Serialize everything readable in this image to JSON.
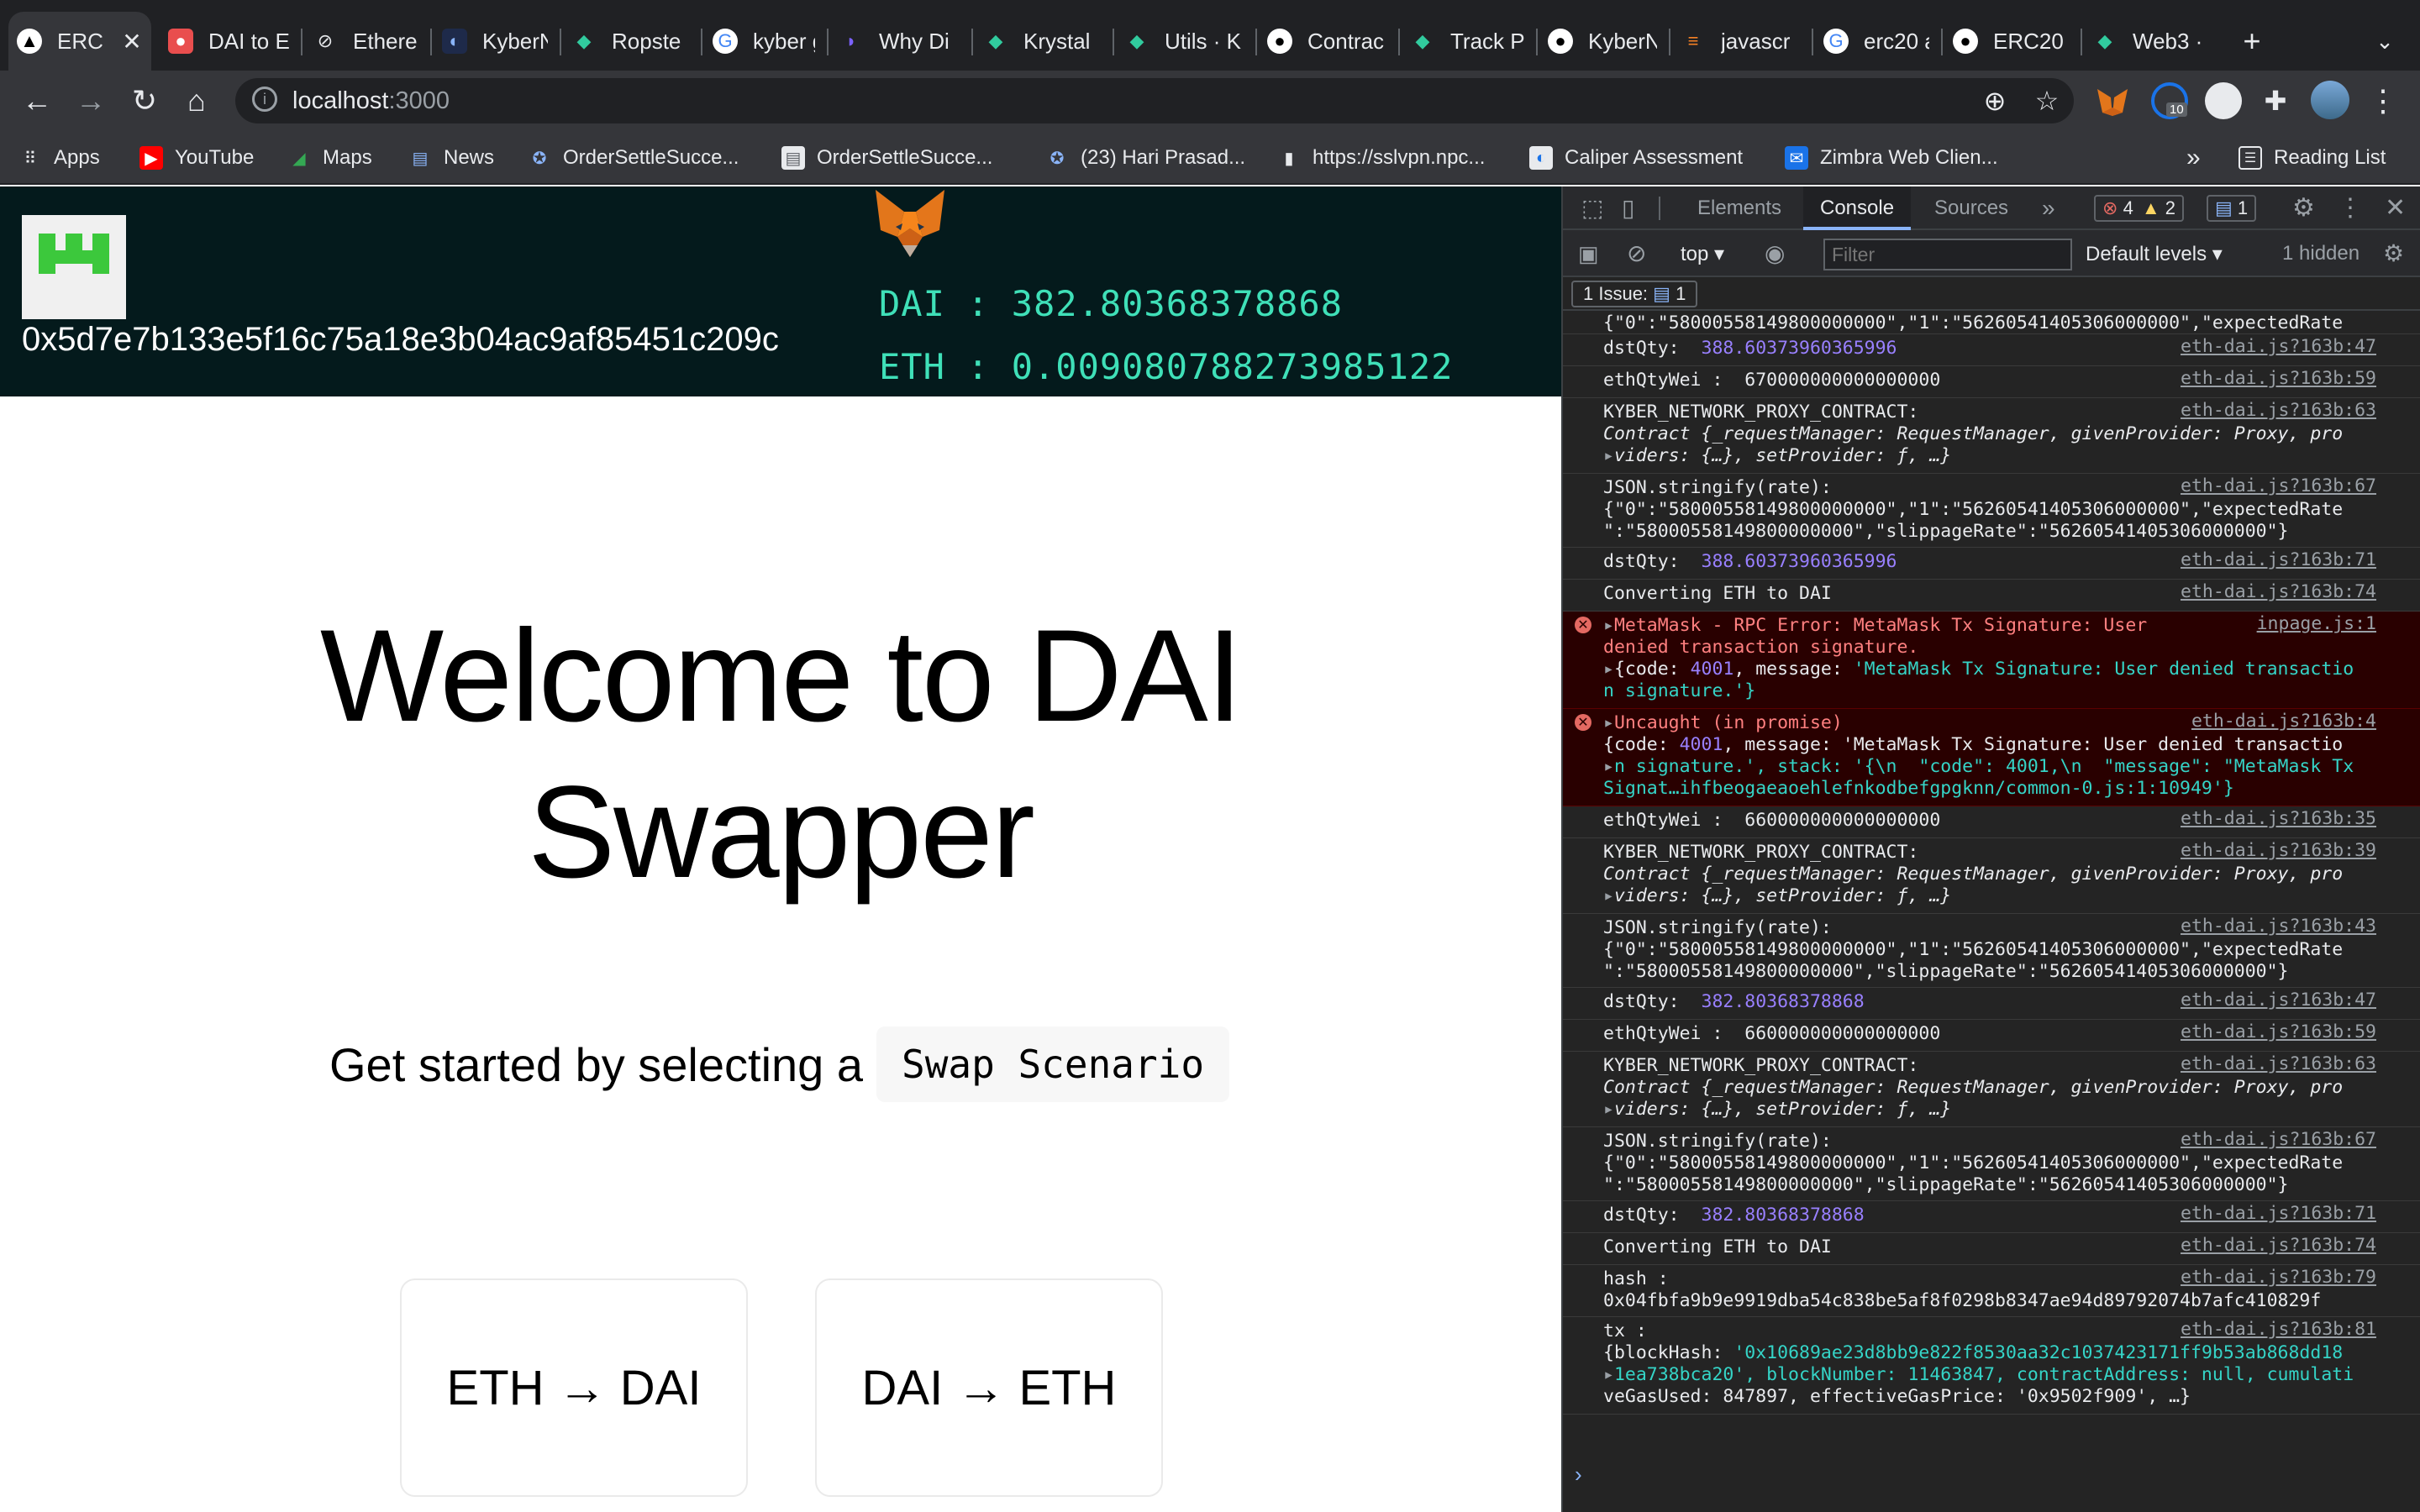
{
  "browser": {
    "tabs": [
      {
        "title": "ERC",
        "icon": "nextjs-icon",
        "active": true
      },
      {
        "title": "DAI to E",
        "icon": "dai-icon"
      },
      {
        "title": "Ethereu",
        "icon": "link-icon"
      },
      {
        "title": "KyberN",
        "icon": "kyber-icon"
      },
      {
        "title": "Ropste",
        "icon": "krystal-icon"
      },
      {
        "title": "kyber g",
        "icon": "google-icon"
      },
      {
        "title": "Why Di",
        "icon": "page-icon"
      },
      {
        "title": "Krystal",
        "icon": "krystal-icon"
      },
      {
        "title": "Utils · K",
        "icon": "krystal-icon"
      },
      {
        "title": "Contrac",
        "icon": "github-icon"
      },
      {
        "title": "Track P",
        "icon": "krystal-icon"
      },
      {
        "title": "KyberN",
        "icon": "github-icon"
      },
      {
        "title": "javascr",
        "icon": "stackoverflow-icon"
      },
      {
        "title": "erc20 a",
        "icon": "google-icon"
      },
      {
        "title": "ERC20",
        "icon": "github-icon"
      },
      {
        "title": "Web3 ·",
        "icon": "krystal-icon"
      }
    ],
    "new_tab": "+",
    "url_host": "localhost",
    "url_port": ":3000",
    "extension_badge": "10",
    "bookmarks": [
      {
        "label": "Apps"
      },
      {
        "label": "YouTube"
      },
      {
        "label": "Maps"
      },
      {
        "label": "News"
      },
      {
        "label": "OrderSettleSucce..."
      },
      {
        "label": "OrderSettleSucce..."
      },
      {
        "label": "(23) Hari Prasad..."
      },
      {
        "label": "https://sslvpn.npc..."
      },
      {
        "label": "Caliper Assessment"
      },
      {
        "label": "Zimbra Web Clien..."
      }
    ],
    "bookmarks_overflow": "»",
    "reading_list": "Reading List"
  },
  "app": {
    "address": "0x5d7e7b133e5f16c75a18e3b04ac9af85451c209c",
    "dai_balance": "DAI : 382.80368378868",
    "eth_balance": "ETH : 0.009080788273985122",
    "title_line1": "Welcome to DAI",
    "title_line2": "Swapper",
    "subtitle": "Get started by selecting a",
    "subtitle_code": "Swap Scenario",
    "cards": [
      "ETH → DAI",
      "DAI → ETH"
    ]
  },
  "devtools": {
    "tabs": [
      "Elements",
      "Console",
      "Sources"
    ],
    "errors": "4",
    "warnings": "2",
    "messages": "1",
    "context": "top",
    "filter_placeholder": "Filter",
    "levels": "Default levels",
    "hidden": "1 hidden",
    "issue_label": "1 Issue:",
    "issue_count": "1"
  },
  "console": {
    "rate_line1": "{\"0\":\"58000558149800000000\",\"1\":\"56260541405306000000\",\"expectedRate",
    "rate_line2": "\":\"58000558149800000000\",\"slippageRate\":\"56260541405306000000\"}",
    "dst1": "388.60373960365996",
    "dst2": "382.80368378868",
    "eth_wei1": "670000000000000000",
    "eth_wei2": "660000000000000000",
    "proxy_label": "KYBER_NETWORK_PROXY_CONTRACT:",
    "proxy_obj1": "Contract {_requestManager: RequestManager, givenProvider: Proxy, pro",
    "proxy_obj2": "viders: {…}, setProvider: ƒ, …}",
    "json_label": "JSON.stringify(rate):",
    "dst_label": "dstQty:",
    "wei_label": "ethQtyWei :",
    "converting": "Converting ETH to DAI",
    "mm_error1": "MetaMask - RPC Error: MetaMask Tx Signature: User",
    "mm_error2": "denied transaction signature.",
    "mm_obj1": "{code: 4001, message: 'MetaMask Tx Signature: User denied transactio",
    "mm_obj2": "n signature.'}",
    "uncaught": "Uncaught (in promise)",
    "unc_obj1": "{code: 4001, message: 'MetaMask Tx Signature: User denied transactio",
    "unc_obj2": "n signature.', stack: '{\\n  \"code\": 4001,\\n  \"message\": \"MetaMask Tx",
    "unc_obj3": "Signat…ihfbeogaeaoehlefnkodbefgpgknn/common-0.js:1:10949'}",
    "hash_label": "hash :",
    "hash_value": "0x04fbfa9b9e9919dba54c838be5af8f0298b8347ae94d89792074b7afc410829f",
    "tx_label": "tx :",
    "tx1": "{blockHash: '0x10689ae23d8bb9e822f8530aa32c1037423171ff9b53ab868dd18",
    "tx2": "1ea738bca20', blockNumber: 11463847, contractAddress: null, cumulati",
    "tx3": "veGasUsed: 847897, effectiveGasPrice: '0x9502f909', …}",
    "src": [
      "eth-dai.js?163b:47",
      "eth-dai.js?163b:59",
      "eth-dai.js?163b:63",
      "eth-dai.js?163b:67",
      "eth-dai.js?163b:71",
      "eth-dai.js?163b:74",
      "inpage.js:1",
      "eth-dai.js?163b:4",
      "eth-dai.js?163b:35",
      "eth-dai.js?163b:39",
      "eth-dai.js?163b:43",
      "eth-dai.js?163b:47",
      "eth-dai.js?163b:59",
      "eth-dai.js?163b:63",
      "eth-dai.js?163b:67",
      "eth-dai.js?163b:71",
      "eth-dai.js?163b:74",
      "eth-dai.js?163b:79",
      "eth-dai.js?163b:81"
    ]
  }
}
